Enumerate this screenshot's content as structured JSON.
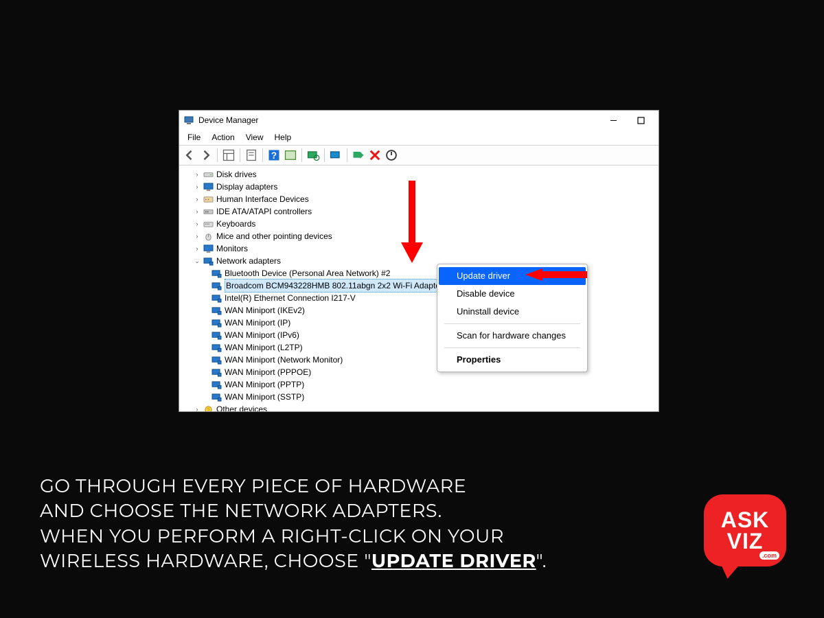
{
  "window": {
    "title": "Device Manager"
  },
  "menus": {
    "file": "File",
    "action": "Action",
    "view": "View",
    "help": "Help"
  },
  "tree": {
    "disk_drives": "Disk drives",
    "display_adapters": "Display adapters",
    "hid": "Human Interface Devices",
    "ide": "IDE ATA/ATAPI controllers",
    "keyboards": "Keyboards",
    "mice": "Mice and other pointing devices",
    "monitors": "Monitors",
    "network_adapters": "Network adapters",
    "net_children": {
      "bt": "Bluetooth Device (Personal Area Network) #2",
      "broadcom": "Broadcom BCM943228HMB 802.11abgn 2x2 Wi-Fi Adapter",
      "intel": "Intel(R) Ethernet Connection I217-V",
      "wan_ikev2": "WAN Miniport (IKEv2)",
      "wan_ip": "WAN Miniport (IP)",
      "wan_ipv6": "WAN Miniport (IPv6)",
      "wan_l2tp": "WAN Miniport (L2TP)",
      "wan_netmon": "WAN Miniport (Network Monitor)",
      "wan_pppoe": "WAN Miniport (PPPOE)",
      "wan_pptp": "WAN Miniport (PPTP)",
      "wan_sstp": "WAN Miniport (SSTP)"
    },
    "other_devices": "Other devices"
  },
  "context_menu": {
    "update": "Update driver",
    "disable": "Disable device",
    "uninstall": "Uninstall device",
    "scan": "Scan for hardware changes",
    "properties": "Properties"
  },
  "caption": {
    "l1": "GO THROUGH EVERY PIECE OF HARDWARE",
    "l2": "AND CHOOSE THE NETWORK ADAPTERS.",
    "l3a": "WHEN YOU PERFORM A RIGHT-CLICK ON YOUR",
    "l4a": "WIRELESS HARDWARE, CHOOSE \"",
    "l4b": "UPDATE DRIVER",
    "l4c": "\"."
  },
  "logo": {
    "t1": "ASK",
    "t2": "VIZ",
    "tcom": ".com"
  }
}
